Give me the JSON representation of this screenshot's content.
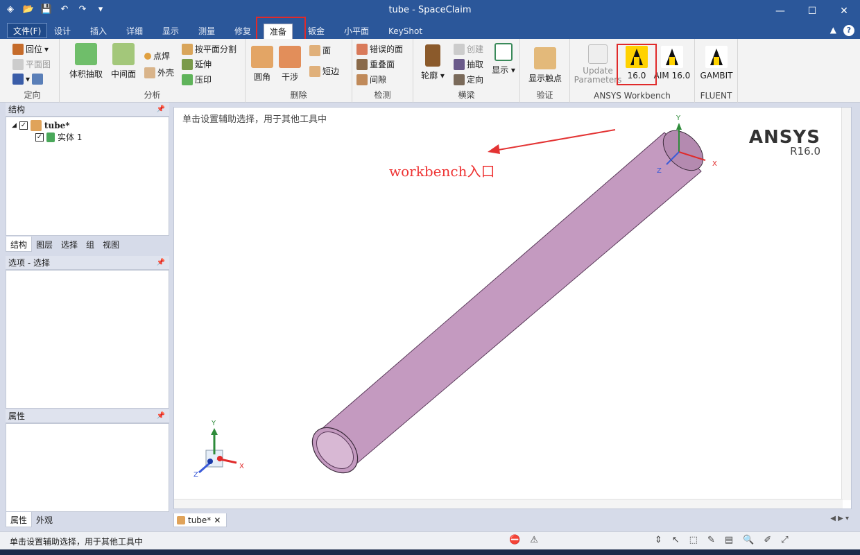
{
  "window": {
    "title": "tube - SpaceClaim"
  },
  "qat": {
    "icons": [
      "spaceclaim-logo-icon",
      "open-icon",
      "save-icon",
      "undo-icon",
      "redo-icon",
      "customize-icon"
    ]
  },
  "tabs": [
    {
      "label": "文件(F)"
    },
    {
      "label": "设计"
    },
    {
      "label": "插入"
    },
    {
      "label": "详细"
    },
    {
      "label": "显示"
    },
    {
      "label": "测量"
    },
    {
      "label": "修复"
    },
    {
      "label": "准备"
    },
    {
      "label": "钣金"
    },
    {
      "label": "小平面"
    },
    {
      "label": "KeyShot"
    }
  ],
  "ribbon": {
    "orient": {
      "label": "定向",
      "home": "回位",
      "plan_view": "平面图"
    },
    "analysis": {
      "label": "分析",
      "volume_extract": "体积抽取",
      "midsurface": "中间面",
      "spot_weld": "点焊",
      "shell": "外壳",
      "split_by_plane": "按平面分割",
      "extend": "延伸",
      "imprint": "压印"
    },
    "remove": {
      "label": "删除",
      "rounds": "圆角",
      "interference": "干涉",
      "faces": "面",
      "short_edges": "短边"
    },
    "detect": {
      "label": "检测",
      "bad_faces": "错误的面",
      "overlap_faces": "重叠面",
      "gaps": "间隙"
    },
    "beams": {
      "label": "横梁",
      "profile": "轮廓",
      "create": "创建",
      "extract": "抽取",
      "orient": "定向",
      "display": "显示"
    },
    "verify": {
      "label": "验证",
      "show_contacts": "显示触点"
    },
    "workbench": {
      "label": "ANSYS Workbench",
      "update": "Update Parameters",
      "wb16": "16.0",
      "aim16": "AIM 16.0"
    },
    "fluent": {
      "label": "FLUENT",
      "gambit": "GAMBIT"
    }
  },
  "structure_panel": {
    "title": "结构",
    "tree": [
      {
        "label": "tube*"
      },
      {
        "label": "实体 1"
      }
    ],
    "subtabs": [
      "结构",
      "图层",
      "选择",
      "组",
      "视图"
    ]
  },
  "options_panel": {
    "title": "选项 - 选择"
  },
  "properties_panel": {
    "title": "属性",
    "subtabs": [
      "属性",
      "外观"
    ]
  },
  "viewport": {
    "hint": "单击设置辅助选择，用于其他工具中",
    "brand": "ANSYS",
    "version": "R16.0",
    "annotation": "workbench入口",
    "axes": {
      "x": "X",
      "y": "Y",
      "z": "Z"
    },
    "colors": {
      "tube": "#c49ac0",
      "annotation": "#e33333"
    }
  },
  "doc_tab": {
    "label": "tube*"
  },
  "status": {
    "text": "单击设置辅助选择，用于其他工具中"
  }
}
